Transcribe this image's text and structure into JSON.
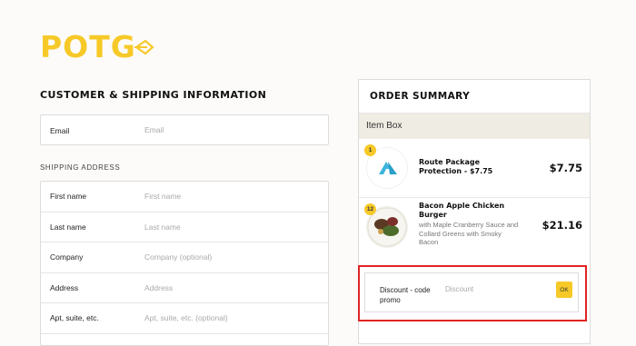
{
  "brand": {
    "logo_text": "POTG",
    "accent": "#f6c928"
  },
  "customer": {
    "title": "CUSTOMER & SHIPPING INFORMATION",
    "email": {
      "label": "Email",
      "placeholder": "Email"
    }
  },
  "shipping": {
    "section_label": "SHIPPING ADDRESS",
    "fields": [
      {
        "label": "First name",
        "placeholder": "First name"
      },
      {
        "label": "Last name",
        "placeholder": "Last name"
      },
      {
        "label": "Company",
        "placeholder": "Company (optional)"
      },
      {
        "label": "Address",
        "placeholder": "Address"
      },
      {
        "label": "Apt, suite, etc.",
        "placeholder": "Apt, suite, etc. (optional)"
      }
    ]
  },
  "summary": {
    "title": "ORDER SUMMARY",
    "group_label": "Item Box",
    "items": [
      {
        "qty": "1",
        "name": "Route Package Protection - $7.75",
        "subtitle": "",
        "price": "$7.75",
        "icon": "route-logo-icon"
      },
      {
        "qty": "12",
        "name": "Bacon Apple Chicken Burger",
        "subtitle": "with Maple Cranberry Sauce and Collard Greens with Smoky Bacon",
        "price": "$21.16",
        "icon": "food-plate-image"
      }
    ],
    "discount": {
      "label": "Discount - code promo",
      "placeholder": "Discount",
      "button_label": "OK"
    }
  },
  "colors": {
    "highlight": "#e02424",
    "background": "#fcfbf9"
  }
}
